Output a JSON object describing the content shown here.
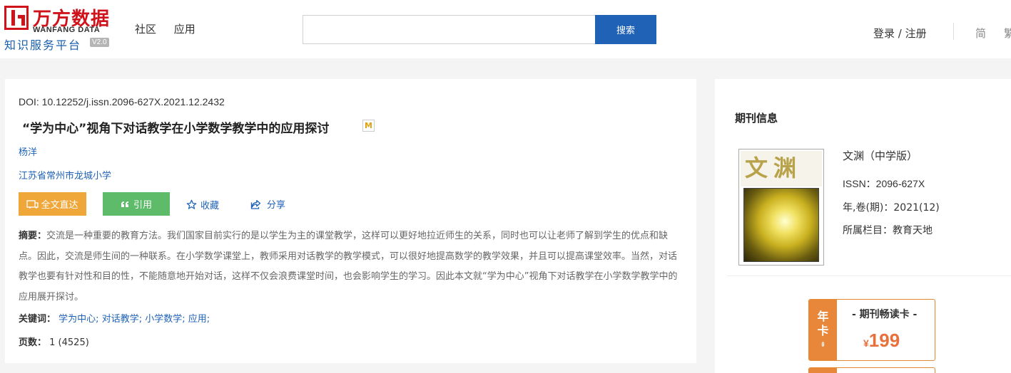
{
  "header": {
    "logo": {
      "cn": "万方数据",
      "en": "WANFANG DATA",
      "subtitle": "知识服务平台",
      "version": "V2.0"
    },
    "nav": [
      "社区",
      "应用"
    ],
    "search": {
      "placeholder": "",
      "button": "搜索"
    },
    "login": "登录 / 注册",
    "lang_simplified": "简",
    "lang_traditional": "繁"
  },
  "article": {
    "doi": "DOI: 10.12252/j.issn.2096-627X.2021.12.2432",
    "title": "“学为中心”视角下对话教学在小学数学教学中的应用探讨",
    "badge": "M",
    "author": "杨洋",
    "organization": "江苏省常州市龙城小学",
    "actions": {
      "fulltext": "全文直达",
      "cite": "引用",
      "favorite": "收藏",
      "share": "分享"
    },
    "abstract_label": "摘要：",
    "abstract": "交流是一种重要的教育方法。我们国家目前实行的是以学生为主的课堂教学，这样可以更好地拉近师生的关系，同时也可以让老师了解到学生的优点和缺点。因此，交流是师生间的一种联系。在小学数学课堂上，教师采用对话教学的教学模式，可以很好地提高数学的教学效果，并且可以提高课堂效率。当然，对话教学也要有针对性和目的性，不能随意地开始对话，这样不仅会浪费课堂时间，也会影响学生的学习。因此本文就“学为中心”视角下对话教学在小学数学教学中的应用展开探讨。",
    "keywords_label": "关键词：",
    "keywords": [
      "学为中心;",
      "对话教学;",
      "小学数学;",
      "应用;"
    ],
    "pages_label": "页数：",
    "pages": "1 (4525)"
  },
  "journal": {
    "section_title": "期刊信息",
    "cover_title": "文渊",
    "name": "文渊（中学版）",
    "issn": "ISSN：2096-627X",
    "volume": "年,卷(期)：2021(12)",
    "column": "所属栏目：教育天地"
  },
  "promo": {
    "badge_chars": [
      "年",
      "卡"
    ],
    "arrow": "⇟",
    "title": "- 期刊畅读卡 -",
    "currency": "¥",
    "price": "199"
  },
  "colors": {
    "brand_red": "#d0121b",
    "link_blue": "#1f62b6",
    "button_orange": "#f0a73a",
    "button_green": "#5dbb6a",
    "promo_orange": "#e8863a"
  },
  "icons": {
    "fulltext": "fulltext-icon",
    "cite": "quote-icon",
    "favorite": "star-icon",
    "share": "share-icon"
  }
}
